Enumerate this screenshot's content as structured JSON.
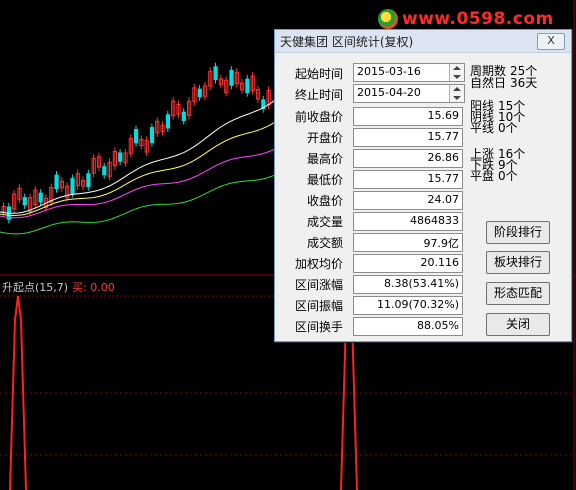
{
  "watermark": {
    "text": "www.0598.com"
  },
  "indicator": {
    "name": "升起点(15,7)",
    "buy": "买: 0.00"
  },
  "colors": {
    "up": "#ff3333",
    "down": "#00e0e0",
    "ma_short": "#ffffff",
    "ma_mid": "#ffff66",
    "ma_long": "#ff44ff",
    "ma_longest": "#33dd33",
    "signal": "#ff2020",
    "grid": "#8a0000"
  },
  "dialog": {
    "title": "天健集团 区间统计(复权)",
    "close": "X",
    "start_label": "起始时间",
    "start_date": "2015-03-16",
    "end_label": "终止时间",
    "end_date": "2015-04-20",
    "rows": [
      {
        "label": "前收盘价",
        "value": "15.69"
      },
      {
        "label": "开盘价",
        "value": "15.77"
      },
      {
        "label": "最高价",
        "value": "26.86"
      },
      {
        "label": "最低价",
        "value": "15.77"
      },
      {
        "label": "收盘价",
        "value": "24.07"
      },
      {
        "label": "成交量",
        "value": "4864833"
      },
      {
        "label": "成交额",
        "value": "97.9亿"
      },
      {
        "label": "加权均价",
        "value": "20.116"
      },
      {
        "label": "区间涨幅",
        "value": "8.38(53.41%)"
      },
      {
        "label": "区间振幅",
        "value": "11.09(70.32%)"
      },
      {
        "label": "区间换手",
        "value": "88.05%"
      }
    ],
    "stats": [
      {
        "label": "周期数",
        "value": "25个"
      },
      {
        "label": "自然日",
        "value": "36天"
      },
      {
        "label": "阳线",
        "value": "15个"
      },
      {
        "label": "阴线",
        "value": "10个"
      },
      {
        "label": "平线",
        "value": "0个"
      },
      {
        "label": "上涨",
        "value": "16个"
      },
      {
        "label": "下跌",
        "value": "9个"
      },
      {
        "label": "平盘",
        "value": "0个"
      }
    ],
    "buttons": [
      "阶段排行",
      "板块排行",
      "形态匹配",
      "关闭"
    ]
  }
}
